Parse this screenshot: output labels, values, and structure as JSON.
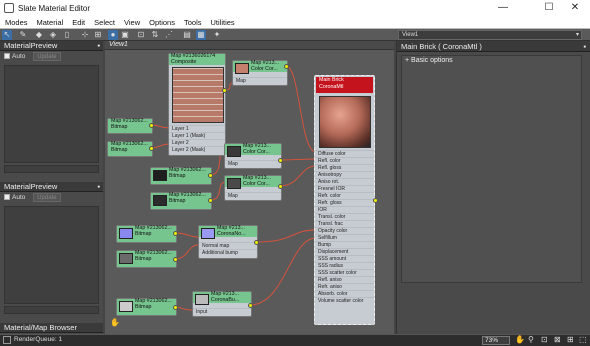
{
  "window": {
    "title": "Slate Material Editor",
    "minimize": "—",
    "maximize": "☐",
    "close": "✕"
  },
  "menu": [
    "Modes",
    "Material",
    "Edit",
    "Select",
    "View",
    "Options",
    "Tools",
    "Utilities"
  ],
  "view_selector": "View1",
  "left_panel": {
    "top": {
      "title": "MaterialPreview",
      "auto_label": "Auto",
      "update_label": "Update"
    },
    "bottom": {
      "title": "MaterialPreview",
      "auto_label": "Auto",
      "update_label": "Update"
    },
    "browser": {
      "title": "Material/Map Browser"
    }
  },
  "view_tab": "View1",
  "right_panel": {
    "title": "Main Brick  ( CoronaMtl )",
    "section": "Basic options"
  },
  "nodes": {
    "composite": {
      "title1": "Map #2136026174",
      "title2": "Composite",
      "rows": [
        "Layer 1",
        "Layer 1 (Mask)",
        "Layer 2",
        "Layer 2 (Mask)"
      ]
    },
    "cc1": {
      "title1": "Map #213...",
      "title2": "Color Cor...",
      "rows": [
        "Map"
      ]
    },
    "cc2": {
      "title1": "Map #213...",
      "title2": "Color Cor...",
      "rows": [
        "Map"
      ]
    },
    "cc3": {
      "title1": "Map #213...",
      "title2": "Color Cor...",
      "rows": [
        "Map"
      ]
    },
    "bm1": {
      "title1": "Map #213062...",
      "title2": "Bitmap"
    },
    "bm2": {
      "title1": "Map #213062...",
      "title2": "Bitmap"
    },
    "bm3": {
      "title1": "Map #213062...",
      "title2": "Bitmap"
    },
    "bm4": {
      "title1": "Map #213062...",
      "title2": "Bitmap"
    },
    "bm5": {
      "title1": "Map #213062...",
      "title2": "Bitmap"
    },
    "bm6": {
      "title1": "Map #213062...",
      "title2": "Bitmap"
    },
    "bm7": {
      "title1": "Map #213062...",
      "title2": "Bitmap"
    },
    "normal": {
      "title1": "Map #213...",
      "title2": "CoronaNo...",
      "rows": [
        "Normal map",
        "Additional bump"
      ]
    },
    "corbump": {
      "title1": "Map #213...",
      "title2": "CoronaBu...",
      "rows": [
        "Input"
      ]
    },
    "main": {
      "title1": "Main Brick",
      "title2": "CoronaMtl",
      "rows": [
        "Diffuse color",
        "Refl. color",
        "Refl. gloss",
        "Anisotropy",
        "Aniso rot.",
        "Fresnel IOR",
        "Refr. color",
        "Refr. gloss",
        "IOR",
        "Transl. color",
        "Transl. frac",
        "Opacity color",
        "Selfillum",
        "Bump",
        "Displacement",
        "SSS amount",
        "SSS radius",
        "SSS scatter color",
        "Refl. aniso",
        "Refr. aniso",
        "Absorb. color",
        "Volume scatter color"
      ]
    }
  },
  "status": {
    "render_queue": "RenderQueue: 1",
    "zoom": "73%"
  },
  "colors": {
    "node_header": "#77c58e",
    "main_header": "#c4131d",
    "socket": "#ecf000",
    "wire": "#e05238"
  }
}
